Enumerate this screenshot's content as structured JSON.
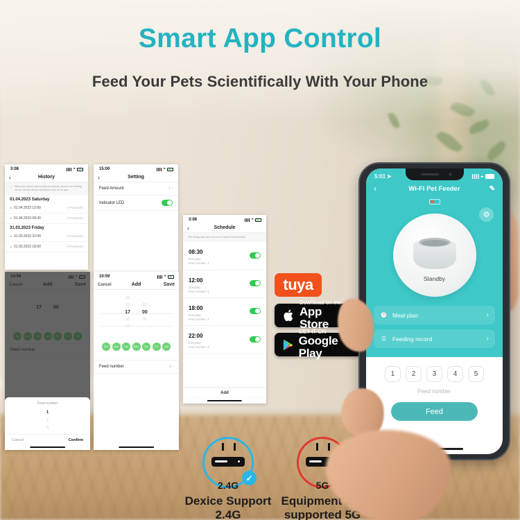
{
  "headings": {
    "title": "Smart App Control",
    "subtitle": "Feed Your Pets Scientifically With Your Phone",
    "title_color": "#23b3c2"
  },
  "shots": {
    "history": {
      "status_time": "3:08",
      "nav_title": "History",
      "back_icon": "chevron-left-icon",
      "note": "When the device has no internet network, there is no feeding record, but the device will deliver food on its plan.",
      "groups": [
        {
          "day": "01.04.2023 Saturday",
          "rows": [
            {
              "time": "01.04.2023 12:00",
              "amount": "4 Portion(s)"
            },
            {
              "time": "01.04.2023 08:30",
              "amount": "4 Portion(s)"
            }
          ]
        },
        {
          "day": "31.03.2023 Friday",
          "rows": [
            {
              "time": "31.03.2023 22:00",
              "amount": "4 Portion(s)"
            },
            {
              "time": "31.03.2023 18:00",
              "amount": "4 Portion(s)"
            }
          ]
        }
      ]
    },
    "setting": {
      "status_time": "15:00",
      "nav_title": "Setting",
      "rows": [
        {
          "label": "Feed Amount",
          "value": "1",
          "type": "link"
        },
        {
          "label": "Indicator LED",
          "value": "on",
          "type": "toggle"
        }
      ]
    },
    "schedule": {
      "status_time": "3:08",
      "nav_title": "Schedule",
      "note": "The timing may have an error of about 30 second(s)",
      "add_label": "Add",
      "items": [
        {
          "time": "08:30",
          "repeat": "Everyday",
          "feed": "Feed number: 4",
          "enabled": "on"
        },
        {
          "time": "12:00",
          "repeat": "Everyday",
          "feed": "Feed number: 4",
          "enabled": "on"
        },
        {
          "time": "18:00",
          "repeat": "Everyday",
          "feed": "Feed number: 4",
          "enabled": "on"
        },
        {
          "time": "22:00",
          "repeat": "Everyday",
          "feed": "Feed number: 4",
          "enabled": "on"
        }
      ]
    },
    "add_dark": {
      "status_time": "10:58",
      "cancel_label": "Cancel",
      "nav_title": "Add",
      "save_label": "Save",
      "hour": "17",
      "minute": "00",
      "days": [
        "Sun",
        "Mon",
        "Tue",
        "Wed",
        "Thu",
        "Fri",
        "Sat"
      ],
      "feed_number_label": "Feed number",
      "sheet": {
        "title": "Feed number",
        "options": [
          "1",
          "2",
          "3"
        ],
        "selected": "1",
        "cancel_label": "Cancel",
        "confirm_label": "Confirm"
      }
    },
    "add_light": {
      "status_time": "10:59",
      "cancel_label": "Cancel",
      "nav_title": "Add",
      "save_label": "Save",
      "hour_above2": "15",
      "hour_above1": "16",
      "hour": "17",
      "minute": "00",
      "hour_below1": "18",
      "hour_below2": "19",
      "minute_above1": "59",
      "minute_below1": "01",
      "days": [
        "Sun",
        "Mon",
        "Tue",
        "Wed",
        "Thu",
        "Fri",
        "Sat"
      ],
      "feed_number_label": "Feed number",
      "feed_number_value": "1"
    }
  },
  "brand": {
    "tuya": "tuya",
    "appstore_small": "Download on the",
    "appstore_big": "App Store",
    "googleplay_small": "GET IT ON",
    "googleplay_big": "Google Play"
  },
  "wifi": {
    "supported": {
      "band": "2.4G",
      "caption_line1": "Dexice Support",
      "caption_line2": "2.4G",
      "mark": "✓",
      "color": "#29b6e8"
    },
    "unsupported": {
      "band": "5G",
      "caption_line1": "Equipment not",
      "caption_line2": "supported 5G",
      "mark": "✕",
      "color": "#e03a2f"
    }
  },
  "phone": {
    "status_time": "5:01",
    "nav_title": "Wi-Fi Pet Feeder",
    "back_icon": "chevron-left-icon",
    "edit_icon": "pencil-icon",
    "gear_icon": "gear-icon",
    "device_state": "Standby",
    "links": [
      {
        "label": "Meal plan",
        "icon": "clock-icon"
      },
      {
        "label": "Feeding record",
        "icon": "list-icon"
      }
    ],
    "numbers": [
      "1",
      "2",
      "3",
      "4",
      "5"
    ],
    "feed_number_label": "Feed number",
    "feed_button": "Feed",
    "accent_color": "#3ec8c8"
  }
}
